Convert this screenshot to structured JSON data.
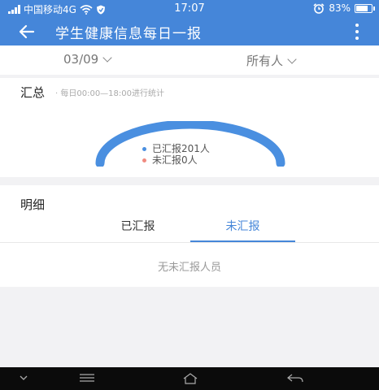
{
  "status_bar": {
    "carrier": "中国移动4G",
    "time": "17:07",
    "battery": "83%",
    "battery_level": 0.83
  },
  "app_bar": {
    "title": "学生健康信息每日一报",
    "back_icon": "arrow-left-icon",
    "menu_icon": "more-vertical-icon"
  },
  "filters": {
    "date": "03/09",
    "scope": "所有人"
  },
  "summary": {
    "title": "汇总",
    "subtitle": "· 每日00:00—18:00进行统计",
    "reported_label": "已汇报201人",
    "unreported_label": "未汇报0人",
    "reported_count": 201,
    "unreported_count": 0,
    "reported_color": "#4a8fe0",
    "unreported_color": "#f08a80"
  },
  "detail": {
    "title": "明细",
    "tabs": [
      {
        "label": "已汇报",
        "active": false
      },
      {
        "label": "未汇报",
        "active": true
      }
    ],
    "empty_text": "无未汇报人员",
    "accent_color": "#4586d9"
  }
}
